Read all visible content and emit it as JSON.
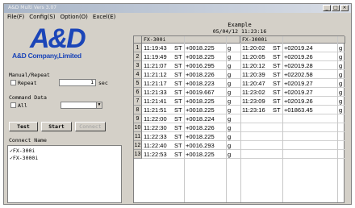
{
  "window": {
    "title": "A&D Multi Vers 3.07",
    "controls": [
      "_",
      "□",
      "×"
    ]
  },
  "menu": [
    "File(F)",
    "Config(S)",
    "Option(O)",
    "Excel(E)"
  ],
  "logo": {
    "mark": "A&D",
    "company": "A&D Company,Limited"
  },
  "manual_repeat": {
    "label": "Manual/Repeat",
    "repeat_label": "Repeat",
    "interval": "1",
    "unit": "sec"
  },
  "command_data": {
    "label": "Command Data",
    "all_label": "All",
    "selected": ""
  },
  "buttons": {
    "test": "Test",
    "start": "Start",
    "disabled": "Connect"
  },
  "connect_name": {
    "label": "Connect Name",
    "items": [
      "FX-300i",
      "FX-3000i"
    ]
  },
  "sheet": {
    "title": "Example",
    "datetime": "05/04/12 11:23:16",
    "columns": [
      "FX-300i",
      "FX-3000i"
    ],
    "rows": [
      {
        "n": "1",
        "t1": "11:19:43",
        "s1": "ST",
        "v1": "+0018.225",
        "u1": "g",
        "t2": "11:20:02",
        "s2": "ST",
        "v2": "+02019.24",
        "u2": "g"
      },
      {
        "n": "2",
        "t1": "11:19:49",
        "s1": "ST",
        "v1": "+0018.225",
        "u1": "g",
        "t2": "11:20:05",
        "s2": "ST",
        "v2": "+02019.26",
        "u2": "g"
      },
      {
        "n": "3",
        "t1": "11:21:07",
        "s1": "ST",
        "v1": "+0016.295",
        "u1": "g",
        "t2": "11:20:12",
        "s2": "ST",
        "v2": "+02019.28",
        "u2": "g"
      },
      {
        "n": "4",
        "t1": "11:21:12",
        "s1": "ST",
        "v1": "+0018.226",
        "u1": "g",
        "t2": "11:20:39",
        "s2": "ST",
        "v2": "+02202.58",
        "u2": "g"
      },
      {
        "n": "5",
        "t1": "11:21:17",
        "s1": "ST",
        "v1": "+0018.223",
        "u1": "g",
        "t2": "11:20:47",
        "s2": "ST",
        "v2": "+02019.27",
        "u2": "g"
      },
      {
        "n": "6",
        "t1": "11:21:33",
        "s1": "ST",
        "v1": "+0019.667",
        "u1": "g",
        "t2": "11:23:02",
        "s2": "ST",
        "v2": "+02019.27",
        "u2": "g"
      },
      {
        "n": "7",
        "t1": "11:21:41",
        "s1": "ST",
        "v1": "+0018.225",
        "u1": "g",
        "t2": "11:23:09",
        "s2": "ST",
        "v2": "+02019.26",
        "u2": "g"
      },
      {
        "n": "8",
        "t1": "11:21:51",
        "s1": "ST",
        "v1": "+0018.225",
        "u1": "g",
        "t2": "11:23:16",
        "s2": "ST",
        "v2": "+01863.45",
        "u2": "g"
      },
      {
        "n": "9",
        "t1": "11:22:00",
        "s1": "ST",
        "v1": "+0018.224",
        "u1": "g",
        "t2": "",
        "s2": "",
        "v2": "",
        "u2": ""
      },
      {
        "n": "10",
        "t1": "11:22:30",
        "s1": "ST",
        "v1": "+0018.226",
        "u1": "g",
        "t2": "",
        "s2": "",
        "v2": "",
        "u2": ""
      },
      {
        "n": "11",
        "t1": "11:22:33",
        "s1": "ST",
        "v1": "+0018.225",
        "u1": "g",
        "t2": "",
        "s2": "",
        "v2": "",
        "u2": ""
      },
      {
        "n": "12",
        "t1": "11:22:40",
        "s1": "ST",
        "v1": "+0016.293",
        "u1": "g",
        "t2": "",
        "s2": "",
        "v2": "",
        "u2": ""
      },
      {
        "n": "13",
        "t1": "11:22:53",
        "s1": "ST",
        "v1": "+0018.225",
        "u1": "g",
        "t2": "",
        "s2": "",
        "v2": "",
        "u2": ""
      }
    ]
  },
  "colors": {
    "logo": "#1b45b8",
    "face": "#d4d0c8"
  }
}
